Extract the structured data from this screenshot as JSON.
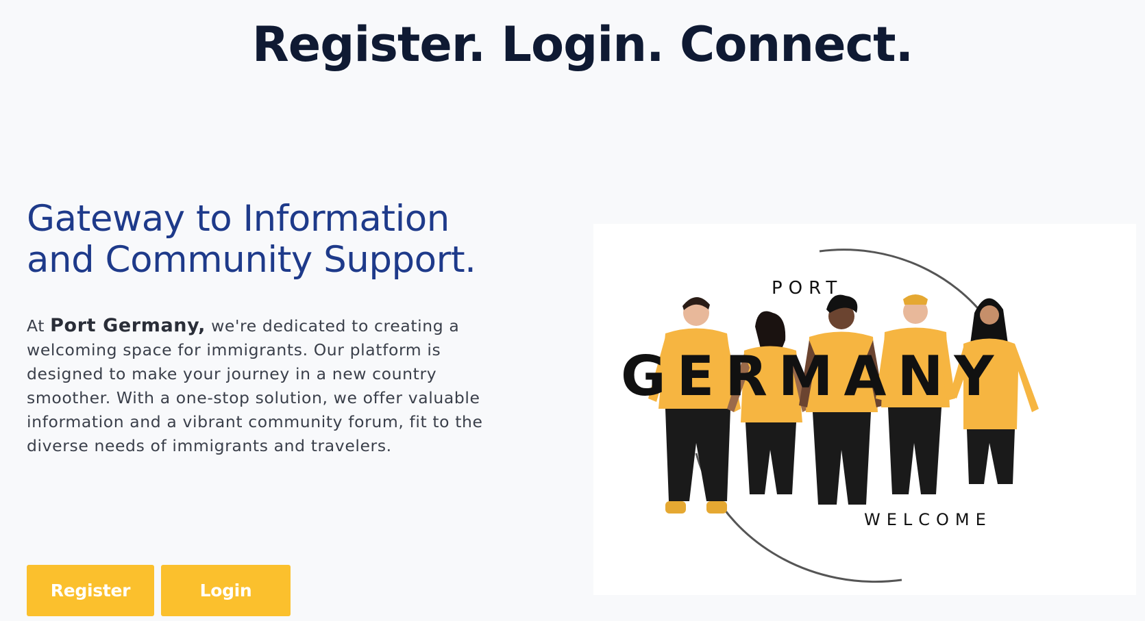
{
  "hero": {
    "title": "Register. Login. Connect."
  },
  "about": {
    "heading": "Gateway to Information and Community Support.",
    "intro_prefix": "At ",
    "brand": "Port Germany,",
    "intro_body": " we're dedicated to creating a welcoming space for immigrants. Our platform is designed to make your journey in a new country smoother. With a one-stop solution, we offer valuable information and a vibrant community forum, fit to the diverse needs of immigrants and travelers."
  },
  "actions": {
    "register_label": "Register",
    "login_label": "Login"
  },
  "logo": {
    "top_word": "PORT",
    "main_word": "GERMANY",
    "bottom_word": "WELCOME"
  },
  "colors": {
    "accent": "#fbc02d",
    "heading_blue": "#1e3a8a",
    "title_dark": "#0f1a33",
    "shirt_yellow": "#f6b541"
  }
}
